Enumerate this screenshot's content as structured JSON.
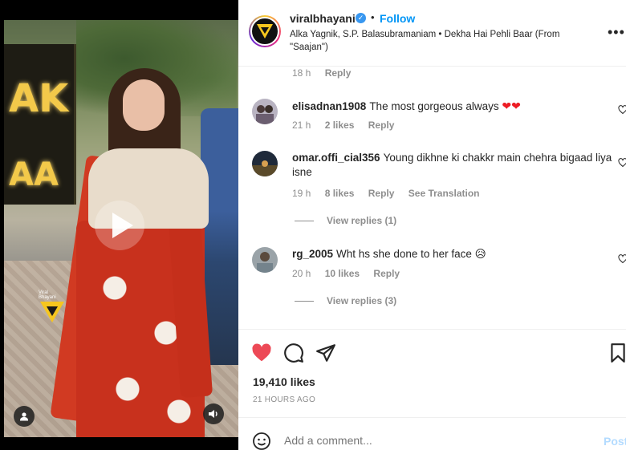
{
  "post": {
    "username": "viralbhayani",
    "verified_icon": "verified-badge-icon",
    "separator": "•",
    "follow_label": "Follow",
    "audio": "Alka Yagnik, S.P. Balasubramaniam • Dekha Hai Pehli Baar (From \"Saajan\")",
    "likes": "19,410 likes",
    "timestamp": "21 HOURS AGO"
  },
  "media": {
    "sign_text_1": "AK",
    "sign_text_2": "AA",
    "watermark": "Viral Bhayani"
  },
  "comments": {
    "top_meta": {
      "time": "18 h",
      "reply": "Reply"
    },
    "items": [
      {
        "username": "elisadnan1908",
        "text": "The most gorgeous always",
        "emoji": "❤❤",
        "time": "21 h",
        "likes": "2 likes",
        "reply": "Reply"
      },
      {
        "username": "omar.offi_cial356",
        "text": "Young dikhne ki chakkr main chehra bigaad liya isne",
        "time": "19 h",
        "likes": "8 likes",
        "reply": "Reply",
        "translate": "See Translation",
        "view_replies": "View replies (1)"
      },
      {
        "username": "rg_2005",
        "text": "Wht hs she done to her face",
        "emoji": "😥",
        "time": "20 h",
        "likes": "10 likes",
        "reply": "Reply",
        "view_replies": "View replies (3)"
      }
    ]
  },
  "compose": {
    "placeholder": "Add a comment...",
    "post_label": "Post"
  },
  "colors": {
    "accent": "#0095f6",
    "like": "#ed4956",
    "muted": "#8e8e8e"
  }
}
